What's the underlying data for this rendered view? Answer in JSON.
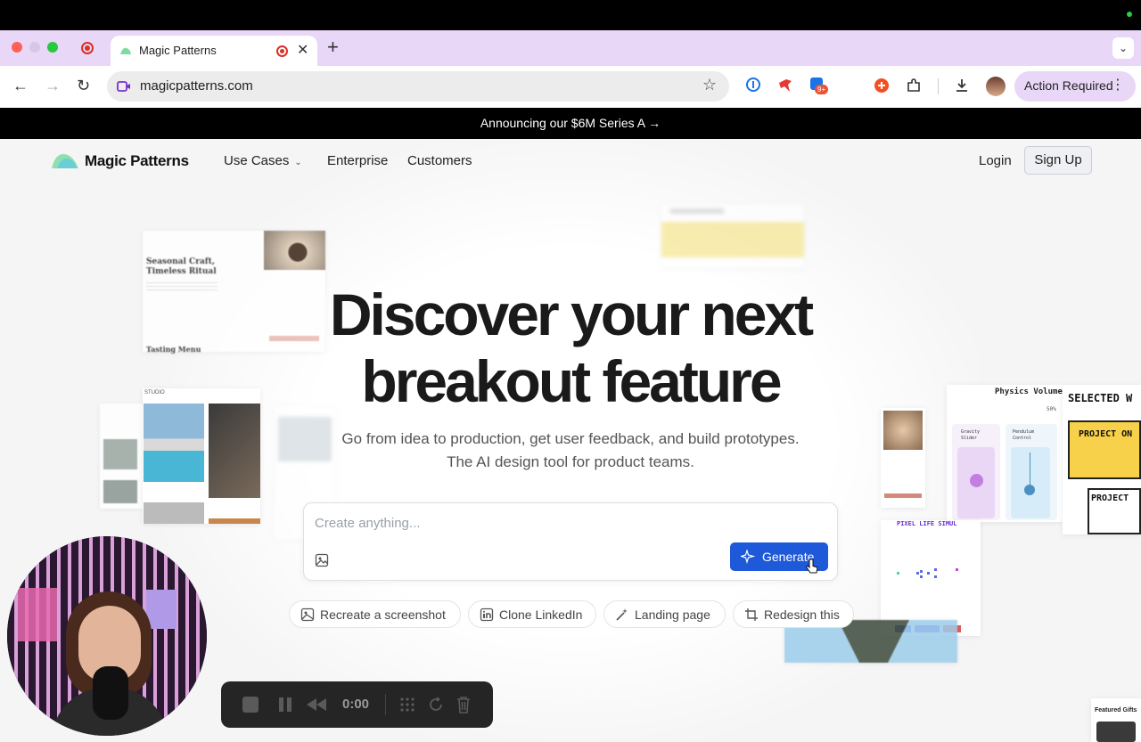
{
  "browser": {
    "tab_title": "Magic Patterns",
    "url": "magicpatterns.com",
    "profile_label": "Action Required",
    "extension_badge": "9+"
  },
  "announcement": "Announcing our $6M Series A →",
  "nav": {
    "brand": "Magic Patterns",
    "use_cases": "Use Cases",
    "enterprise": "Enterprise",
    "customers": "Customers",
    "login": "Login",
    "signup": "Sign Up"
  },
  "hero": {
    "title_line1": "Discover your next",
    "title_line2": "breakout feature",
    "sub_line1": "Go from idea to production, get user feedback, and build prototypes.",
    "sub_line2": "The AI design tool for product teams."
  },
  "prompt": {
    "placeholder": "Create anything...",
    "generate": "Generate"
  },
  "chips": [
    {
      "label": "Recreate a screenshot"
    },
    {
      "label": "Clone LinkedIn"
    },
    {
      "label": "Landing page"
    },
    {
      "label": "Redesign this"
    }
  ],
  "preview_cards": {
    "seasonal_title": "Seasonal Craft, Timeless Ritual",
    "tasting_menu": "Tasting Menu",
    "studio": "STUDIO",
    "physics": "Physics Volume",
    "physics_pct": "50%",
    "gravity": "Gravity Slider",
    "pendulum": "Pendulum Control",
    "selected_works": "SELECTED W",
    "project_one": "PROJECT ON",
    "project_two": "PROJECT",
    "pixel_life": "PIXEL LIFE SIMUL",
    "featured_gifts": "Featured Gifts"
  },
  "recorder": {
    "time": "0:00"
  },
  "colors": {
    "accent": "#1e59d9",
    "tab_bar": "#e8d7f7",
    "announcement_bg": "#000000"
  }
}
